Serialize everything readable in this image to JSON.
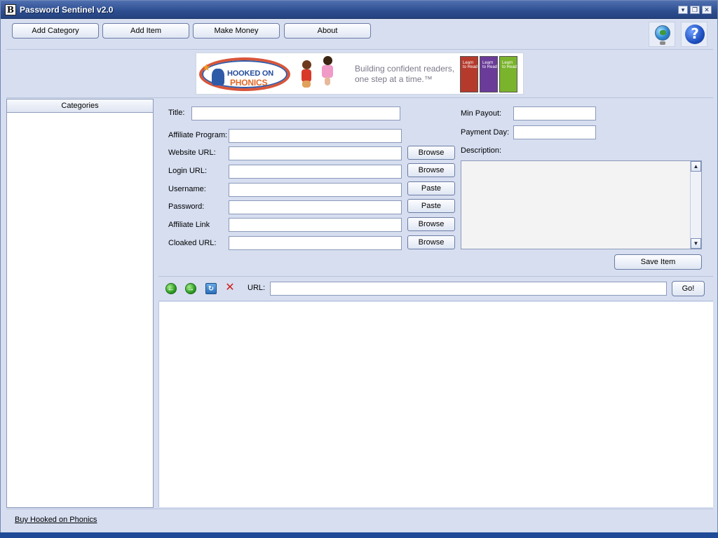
{
  "window": {
    "title": "Password Sentinel v2.0",
    "app_icon": "B",
    "controls": {
      "minimize": "▾",
      "restore": "❐",
      "close": "✕"
    }
  },
  "toolbar": {
    "buttons": [
      {
        "label": "Add Category"
      },
      {
        "label": "Add Item"
      },
      {
        "label": "Make Money"
      },
      {
        "label": "About"
      }
    ],
    "globe_icon": "globe-icon",
    "help_label": "?"
  },
  "banner": {
    "logo_line1": "HOOKED ON",
    "logo_line2": "PHONICS",
    "tagline_line1": "Building confident readers,",
    "tagline_line2": "one step at a time.™",
    "books": [
      "Learn to Read",
      "Learn to Read",
      "Learn to Read"
    ]
  },
  "categories": {
    "header": "Categories",
    "items": []
  },
  "form": {
    "title_label": "Title:",
    "title_value": "",
    "affiliate_program_label": "Affiliate Program:",
    "affiliate_program_value": "",
    "website_url_label": "Website URL:",
    "website_url_value": "",
    "login_url_label": "Login URL:",
    "login_url_value": "",
    "username_label": "Username:",
    "username_value": "",
    "password_label": "Password:",
    "password_value": "",
    "affiliate_link_label": "Affiliate Link",
    "affiliate_link_value": "",
    "cloaked_url_label": "Cloaked URL:",
    "cloaked_url_value": "",
    "browse_label": "Browse",
    "paste_label": "Paste",
    "min_payout_label": "Min Payout:",
    "min_payout_value": "",
    "payment_day_label": "Payment Day:",
    "payment_day_value": "",
    "description_label": "Description:",
    "description_value": "",
    "save_label": "Save Item"
  },
  "browser_nav": {
    "back_icon": "back-arrow-icon",
    "forward_icon": "forward-arrow-icon",
    "refresh_icon": "refresh-icon",
    "stop_icon": "stop-icon",
    "url_label": "URL:",
    "url_value": "",
    "go_label": "Go!"
  },
  "status": {
    "link_text": "Buy Hooked on Phonics"
  },
  "colors": {
    "window_bg": "#d6def0",
    "titlebar": "#2c4d8f",
    "accent_green": "#2f9d25",
    "stop_red": "#d0201a"
  }
}
